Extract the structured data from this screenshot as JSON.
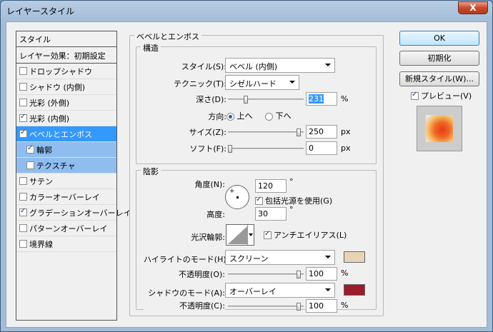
{
  "window": {
    "title": "レイヤースタイル",
    "close": "X"
  },
  "sidebar": {
    "header": "スタイル",
    "effects_header": "レイヤー効果：初期設定",
    "items": [
      {
        "label": "ドロップシャドウ",
        "checked": false
      },
      {
        "label": "シャドウ (内側)",
        "checked": false
      },
      {
        "label": "光彩 (外側)",
        "checked": false
      },
      {
        "label": "光彩 (内側)",
        "checked": true
      },
      {
        "label": "ベベルとエンボス",
        "checked": true
      },
      {
        "label": "輪郭",
        "checked": true
      },
      {
        "label": "テクスチャ",
        "checked": false
      },
      {
        "label": "サテン",
        "checked": false
      },
      {
        "label": "カラーオーバーレイ",
        "checked": false
      },
      {
        "label": "グラデーションオーバーレイ",
        "checked": true
      },
      {
        "label": "パターンオーバーレイ",
        "checked": false
      },
      {
        "label": "境界線",
        "checked": false
      }
    ]
  },
  "bevel": {
    "title": "ベベルとエンボス",
    "structure": {
      "title": "構造",
      "style_label": "スタイル(S):",
      "style_value": "ベベル (内側)",
      "technique_label": "テクニック(T):",
      "technique_value": "シゼルハード",
      "depth_label": "深さ(D):",
      "depth_value": "231",
      "depth_unit": "%",
      "direction_label": "方向:",
      "dir_up": "上へ",
      "dir_down": "下へ",
      "size_label": "サイズ(Z):",
      "size_value": "250",
      "size_unit": "px",
      "soften_label": "ソフト(F):",
      "soften_value": "0",
      "soften_unit": "px"
    },
    "shading": {
      "title": "陰影",
      "angle_label": "角度(N):",
      "angle_value": "120",
      "angle_unit": "°",
      "global_light": "包括光源を使用(G)",
      "altitude_label": "高度:",
      "altitude_value": "30",
      "altitude_unit": "°",
      "gloss_label": "光沢輪郭:",
      "antialias": "アンチエイリアス(L)",
      "highlight_label": "ハイライトのモード(H):",
      "highlight_mode": "スクリーン",
      "highlight_color": "#e6d4b4",
      "hl_opacity_label": "不透明度(O):",
      "hl_opacity": "100",
      "hl_opacity_unit": "%",
      "shadow_label": "シャドウのモード(A):",
      "shadow_mode": "オーバーレイ",
      "shadow_color": "#9b1c2a",
      "sh_opacity_label": "不透明度(C):",
      "sh_opacity": "100",
      "sh_opacity_unit": "%"
    }
  },
  "buttons": {
    "ok": "OK",
    "reset": "初期化",
    "new_style": "新規スタイル(W)...",
    "preview": "プレビュー(V)"
  }
}
